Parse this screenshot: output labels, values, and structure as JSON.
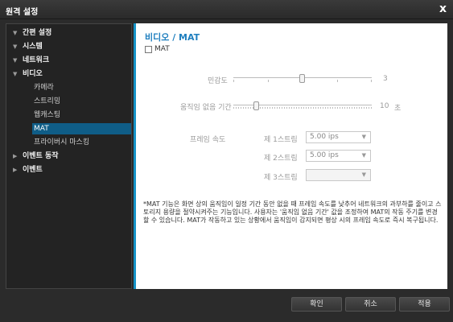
{
  "window": {
    "title": "원격 설정",
    "close_symbol": "x"
  },
  "sidebar": {
    "items": [
      {
        "label": "간편 설정",
        "level": "top",
        "arrow": "▼"
      },
      {
        "label": "시스템",
        "level": "top",
        "arrow": "▼"
      },
      {
        "label": "네트워크",
        "level": "top",
        "arrow": "▼"
      },
      {
        "label": "비디오",
        "level": "top",
        "arrow": "▼"
      },
      {
        "label": "카메라",
        "level": "sub"
      },
      {
        "label": "스트리밍",
        "level": "sub"
      },
      {
        "label": "웹캐스팅",
        "level": "sub"
      },
      {
        "label": "MAT",
        "level": "sub",
        "selected": true
      },
      {
        "label": "프라이버시 마스킹",
        "level": "sub"
      },
      {
        "label": "이벤트 동작",
        "level": "top",
        "arrow": "▶"
      },
      {
        "label": "이벤트",
        "level": "top",
        "arrow": "▶"
      }
    ]
  },
  "main": {
    "title": "비디오 / MAT",
    "mat_checkbox": {
      "label": "MAT",
      "checked": false
    },
    "sensitivity": {
      "label": "민감도",
      "value": "3",
      "level": 3,
      "max": 5
    },
    "inactivity": {
      "label": "움직임 없음 기간",
      "value": "10",
      "unit": "초"
    },
    "frame_rate": {
      "label": "프레임 속도",
      "streams": [
        {
          "label": "제 1스트림",
          "value": "5.00 ips",
          "enabled": true
        },
        {
          "label": "제 2스트림",
          "value": "5.00 ips",
          "enabled": true
        },
        {
          "label": "제 3스트림",
          "value": "",
          "enabled": false
        }
      ]
    },
    "note": "*MAT 기능은 화면 상의 움직임이 일정 기간 동안 없을 때 프레임 속도를 낮추어 네트워크의 과부하를 줄이고 스토리지 용량을 절약시켜주는 기능입니다. 사용자는 '움직임 없음 기간' 값을 조정하여 MAT의 작동 주기를 변경할 수 있습니다. MAT가 작동하고 있는 상황에서 움직임이 감지되면 평상 시의 프레임 속도로 즉시 복구됩니다."
  },
  "footer": {
    "confirm": "확인",
    "cancel": "취소",
    "apply": "적용"
  },
  "colors": {
    "accent": "#1593c7",
    "selected_nav": "#0f5d87",
    "title_text": "#1f7fbf"
  },
  "icons": {
    "close": "close-icon",
    "expanded": "triangle-down-icon",
    "collapsed": "triangle-right-icon",
    "dropdown": "chevron-down-icon"
  }
}
